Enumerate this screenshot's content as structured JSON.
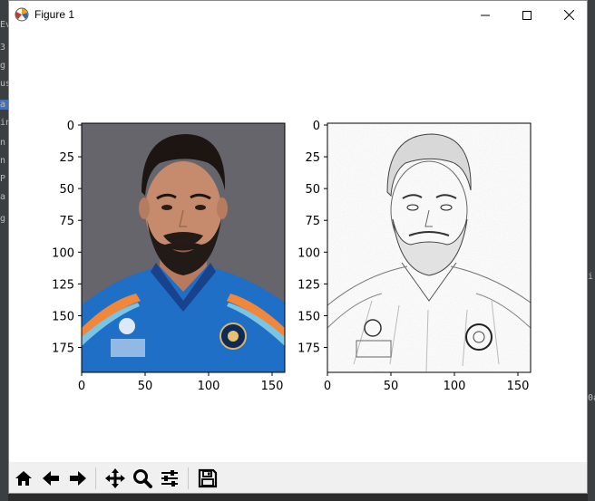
{
  "window": {
    "title": "Figure 1"
  },
  "titlebar_buttons": [
    {
      "name": "minimize-button",
      "icon": "minimize-icon"
    },
    {
      "name": "maximize-button",
      "icon": "maximize-icon"
    },
    {
      "name": "close-button",
      "icon": "close-icon"
    }
  ],
  "plots": [
    {
      "name": "original-photo-axes",
      "image": "color-photo",
      "xticks": [
        "0",
        "50",
        "100",
        "150"
      ],
      "yticks": [
        "0",
        "25",
        "50",
        "75",
        "100",
        "125",
        "150",
        "175"
      ]
    },
    {
      "name": "pencil-sketch-axes",
      "image": "pencil-sketch",
      "xticks": [
        "0",
        "50",
        "100",
        "150"
      ],
      "yticks": [
        "0",
        "25",
        "50",
        "75",
        "100",
        "125",
        "150",
        "175"
      ]
    }
  ],
  "toolbar": {
    "buttons": [
      {
        "name": "home-button",
        "icon": "home-icon"
      },
      {
        "name": "back-button",
        "icon": "arrow-left-icon"
      },
      {
        "name": "forward-button",
        "icon": "arrow-right-icon"
      },
      {
        "name": "pan-button",
        "icon": "move-icon"
      },
      {
        "name": "zoom-button",
        "icon": "magnifier-icon"
      },
      {
        "name": "configure-subplots-button",
        "icon": "sliders-icon"
      },
      {
        "name": "save-button",
        "icon": "floppy-disk-icon"
      }
    ]
  },
  "background_fragments": {
    "left": [
      "Ev",
      "3",
      "g",
      "us",
      "a",
      "in",
      "n",
      "n",
      "P",
      "a",
      "g"
    ],
    "right": [
      "i",
      "0a"
    ]
  }
}
